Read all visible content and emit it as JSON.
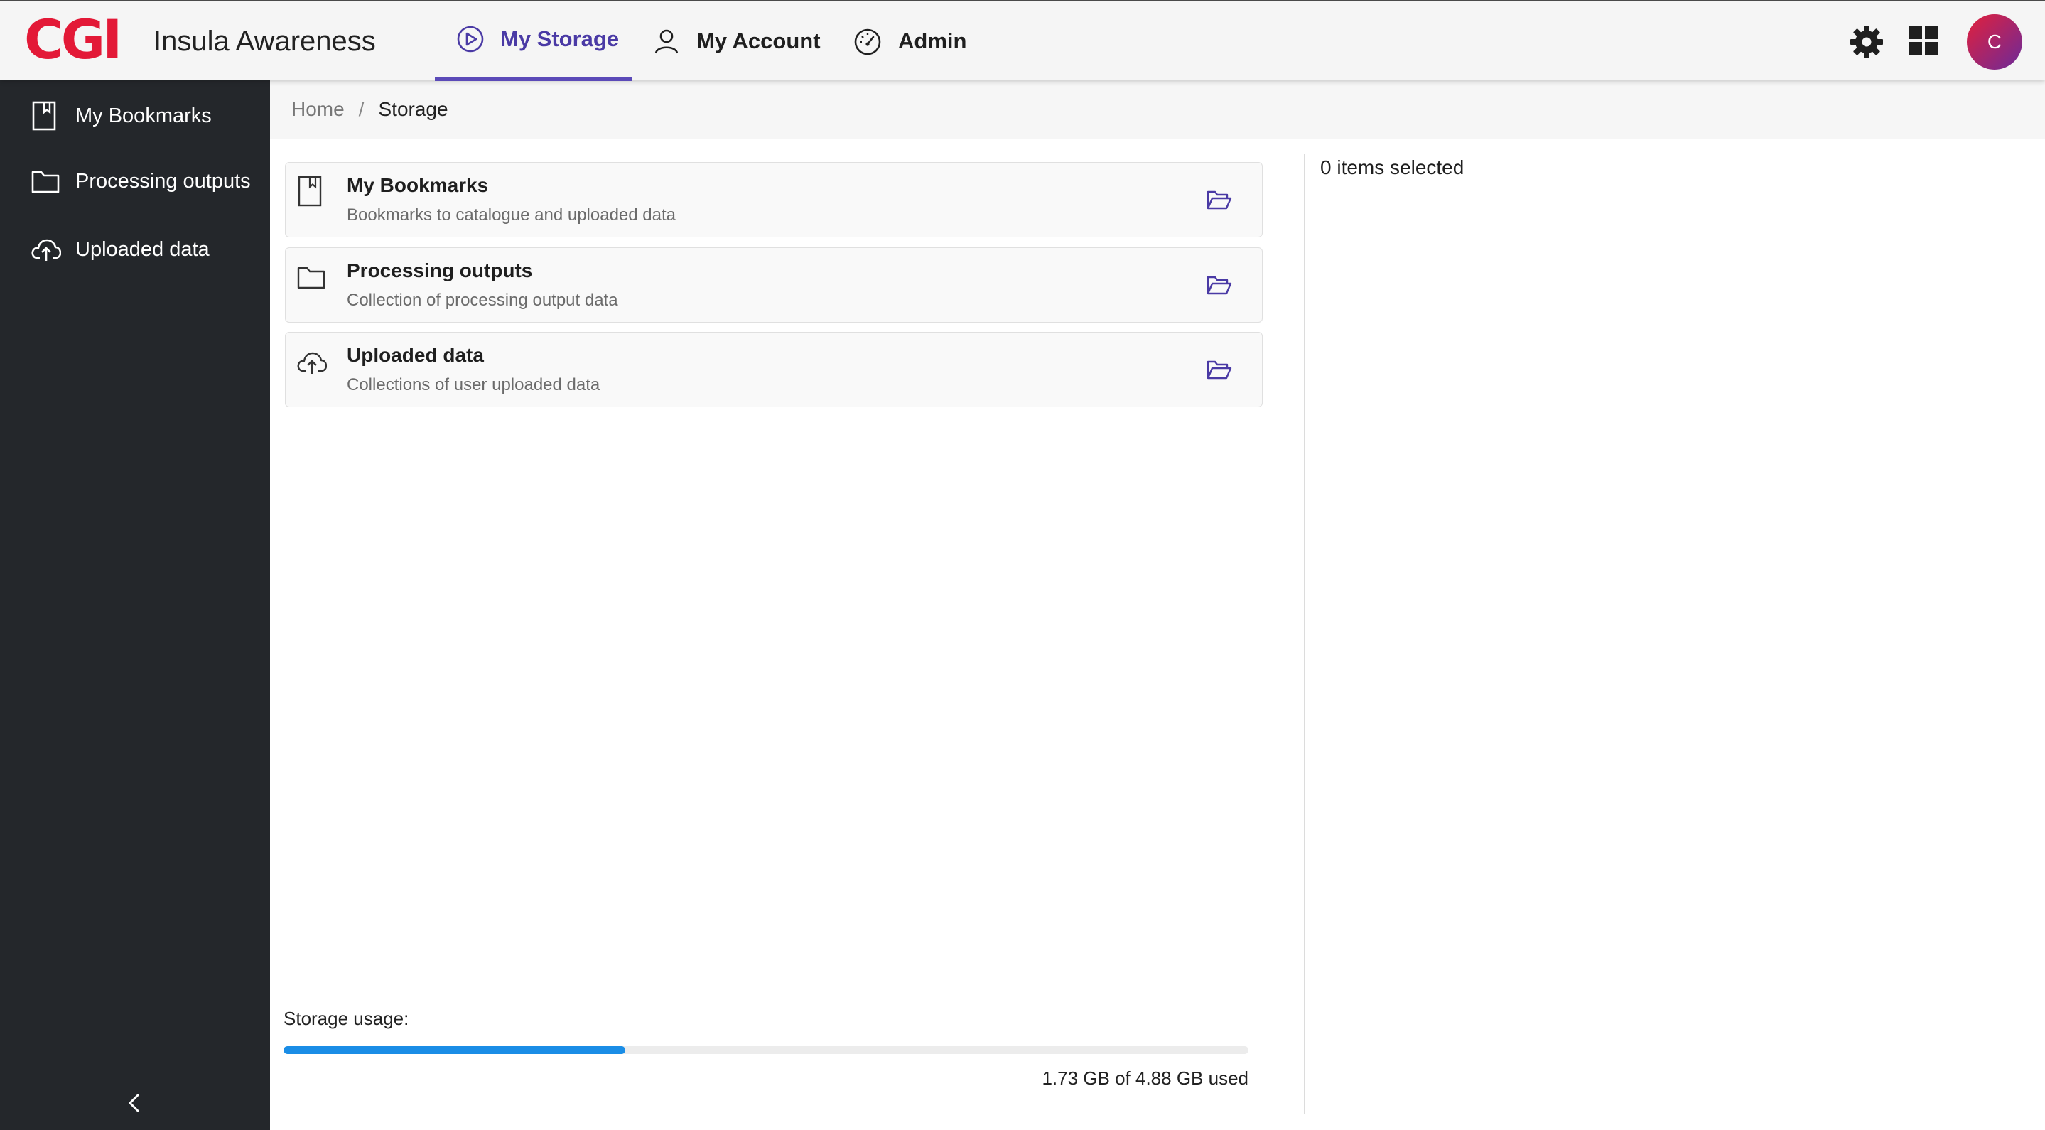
{
  "header": {
    "logo_text": "CGI",
    "app_title": "Insula Awareness",
    "tabs": [
      {
        "label": "My Storage",
        "icon": "play-circle-icon",
        "active": true
      },
      {
        "label": "My Account",
        "icon": "user-icon",
        "active": false
      },
      {
        "label": "Admin",
        "icon": "gauge-icon",
        "active": false
      }
    ],
    "avatar_initial": "C",
    "accent_color": "#5b4ab8",
    "brand_color": "#e31937"
  },
  "sidebar": {
    "items": [
      {
        "label": "My Bookmarks",
        "icon": "bookmark-icon"
      },
      {
        "label": "Processing outputs",
        "icon": "folder-icon"
      },
      {
        "label": "Uploaded data",
        "icon": "cloud-upload-icon"
      }
    ],
    "collapse_icon": "chevron-left-icon"
  },
  "breadcrumb": {
    "home": "Home",
    "separator": "/",
    "current": "Storage"
  },
  "storage": {
    "cards": [
      {
        "title": "My Bookmarks",
        "description": "Bookmarks to catalogue and uploaded data",
        "icon": "bookmark-icon"
      },
      {
        "title": "Processing outputs",
        "description": "Collection of processing output data",
        "icon": "folder-icon"
      },
      {
        "title": "Uploaded data",
        "description": "Collections of user uploaded data",
        "icon": "cloud-upload-icon"
      }
    ],
    "open_icon": "folder-open-icon"
  },
  "selection": {
    "text": "0 items selected"
  },
  "usage": {
    "label": "Storage usage:",
    "used_gb": 1.73,
    "total_gb": 4.88,
    "text": "1.73 GB of 4.88 GB used",
    "bar_color": "#1a8de6"
  }
}
